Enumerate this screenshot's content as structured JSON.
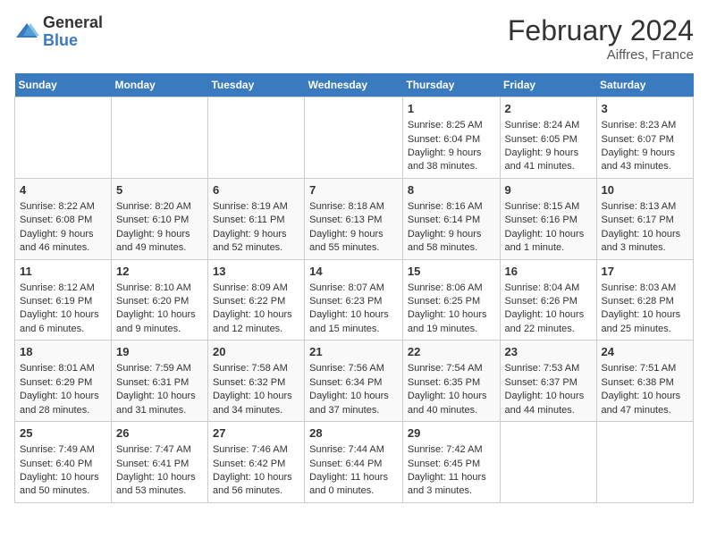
{
  "header": {
    "logo_general": "General",
    "logo_blue": "Blue",
    "month_title": "February 2024",
    "location": "Aiffres, France"
  },
  "days_of_week": [
    "Sunday",
    "Monday",
    "Tuesday",
    "Wednesday",
    "Thursday",
    "Friday",
    "Saturday"
  ],
  "weeks": [
    [
      {
        "day": "",
        "content": ""
      },
      {
        "day": "",
        "content": ""
      },
      {
        "day": "",
        "content": ""
      },
      {
        "day": "",
        "content": ""
      },
      {
        "day": "1",
        "content": "Sunrise: 8:25 AM\nSunset: 6:04 PM\nDaylight: 9 hours and 38 minutes."
      },
      {
        "day": "2",
        "content": "Sunrise: 8:24 AM\nSunset: 6:05 PM\nDaylight: 9 hours and 41 minutes."
      },
      {
        "day": "3",
        "content": "Sunrise: 8:23 AM\nSunset: 6:07 PM\nDaylight: 9 hours and 43 minutes."
      }
    ],
    [
      {
        "day": "4",
        "content": "Sunrise: 8:22 AM\nSunset: 6:08 PM\nDaylight: 9 hours and 46 minutes."
      },
      {
        "day": "5",
        "content": "Sunrise: 8:20 AM\nSunset: 6:10 PM\nDaylight: 9 hours and 49 minutes."
      },
      {
        "day": "6",
        "content": "Sunrise: 8:19 AM\nSunset: 6:11 PM\nDaylight: 9 hours and 52 minutes."
      },
      {
        "day": "7",
        "content": "Sunrise: 8:18 AM\nSunset: 6:13 PM\nDaylight: 9 hours and 55 minutes."
      },
      {
        "day": "8",
        "content": "Sunrise: 8:16 AM\nSunset: 6:14 PM\nDaylight: 9 hours and 58 minutes."
      },
      {
        "day": "9",
        "content": "Sunrise: 8:15 AM\nSunset: 6:16 PM\nDaylight: 10 hours and 1 minute."
      },
      {
        "day": "10",
        "content": "Sunrise: 8:13 AM\nSunset: 6:17 PM\nDaylight: 10 hours and 3 minutes."
      }
    ],
    [
      {
        "day": "11",
        "content": "Sunrise: 8:12 AM\nSunset: 6:19 PM\nDaylight: 10 hours and 6 minutes."
      },
      {
        "day": "12",
        "content": "Sunrise: 8:10 AM\nSunset: 6:20 PM\nDaylight: 10 hours and 9 minutes."
      },
      {
        "day": "13",
        "content": "Sunrise: 8:09 AM\nSunset: 6:22 PM\nDaylight: 10 hours and 12 minutes."
      },
      {
        "day": "14",
        "content": "Sunrise: 8:07 AM\nSunset: 6:23 PM\nDaylight: 10 hours and 15 minutes."
      },
      {
        "day": "15",
        "content": "Sunrise: 8:06 AM\nSunset: 6:25 PM\nDaylight: 10 hours and 19 minutes."
      },
      {
        "day": "16",
        "content": "Sunrise: 8:04 AM\nSunset: 6:26 PM\nDaylight: 10 hours and 22 minutes."
      },
      {
        "day": "17",
        "content": "Sunrise: 8:03 AM\nSunset: 6:28 PM\nDaylight: 10 hours and 25 minutes."
      }
    ],
    [
      {
        "day": "18",
        "content": "Sunrise: 8:01 AM\nSunset: 6:29 PM\nDaylight: 10 hours and 28 minutes."
      },
      {
        "day": "19",
        "content": "Sunrise: 7:59 AM\nSunset: 6:31 PM\nDaylight: 10 hours and 31 minutes."
      },
      {
        "day": "20",
        "content": "Sunrise: 7:58 AM\nSunset: 6:32 PM\nDaylight: 10 hours and 34 minutes."
      },
      {
        "day": "21",
        "content": "Sunrise: 7:56 AM\nSunset: 6:34 PM\nDaylight: 10 hours and 37 minutes."
      },
      {
        "day": "22",
        "content": "Sunrise: 7:54 AM\nSunset: 6:35 PM\nDaylight: 10 hours and 40 minutes."
      },
      {
        "day": "23",
        "content": "Sunrise: 7:53 AM\nSunset: 6:37 PM\nDaylight: 10 hours and 44 minutes."
      },
      {
        "day": "24",
        "content": "Sunrise: 7:51 AM\nSunset: 6:38 PM\nDaylight: 10 hours and 47 minutes."
      }
    ],
    [
      {
        "day": "25",
        "content": "Sunrise: 7:49 AM\nSunset: 6:40 PM\nDaylight: 10 hours and 50 minutes."
      },
      {
        "day": "26",
        "content": "Sunrise: 7:47 AM\nSunset: 6:41 PM\nDaylight: 10 hours and 53 minutes."
      },
      {
        "day": "27",
        "content": "Sunrise: 7:46 AM\nSunset: 6:42 PM\nDaylight: 10 hours and 56 minutes."
      },
      {
        "day": "28",
        "content": "Sunrise: 7:44 AM\nSunset: 6:44 PM\nDaylight: 11 hours and 0 minutes."
      },
      {
        "day": "29",
        "content": "Sunrise: 7:42 AM\nSunset: 6:45 PM\nDaylight: 11 hours and 3 minutes."
      },
      {
        "day": "",
        "content": ""
      },
      {
        "day": "",
        "content": ""
      }
    ]
  ]
}
